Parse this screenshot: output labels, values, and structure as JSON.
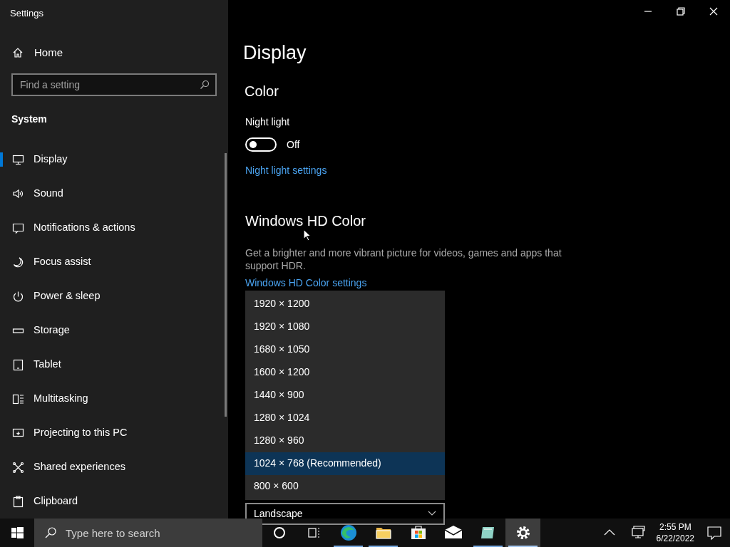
{
  "window": {
    "title": "Settings"
  },
  "sidebar": {
    "home": "Home",
    "search": {
      "placeholder": "Find a setting"
    },
    "section": "System",
    "items": [
      {
        "kind": "display",
        "label": "Display",
        "selected": true
      },
      {
        "kind": "sound",
        "label": "Sound",
        "selected": false
      },
      {
        "kind": "notifications",
        "label": "Notifications & actions",
        "selected": false
      },
      {
        "kind": "focus",
        "label": "Focus assist",
        "selected": false
      },
      {
        "kind": "power",
        "label": "Power & sleep",
        "selected": false
      },
      {
        "kind": "storage",
        "label": "Storage",
        "selected": false
      },
      {
        "kind": "tablet",
        "label": "Tablet",
        "selected": false
      },
      {
        "kind": "multitasking",
        "label": "Multitasking",
        "selected": false
      },
      {
        "kind": "projecting",
        "label": "Projecting to this PC",
        "selected": false
      },
      {
        "kind": "shared",
        "label": "Shared experiences",
        "selected": false
      },
      {
        "kind": "clipboard",
        "label": "Clipboard",
        "selected": false
      }
    ]
  },
  "content": {
    "title": "Display",
    "section": "Color",
    "night_light": {
      "label": "Night light",
      "on": false,
      "state_text": "Off",
      "link": "Night light settings"
    },
    "hd_color": {
      "heading": "Windows HD Color",
      "description": "Get a brighter and more vibrant picture for videos, games and apps that support HDR.",
      "link": "Windows HD Color settings"
    },
    "resolution_options": [
      {
        "label": "1920 × 1200",
        "selected": false
      },
      {
        "label": "1920 × 1080",
        "selected": false
      },
      {
        "label": "1680 × 1050",
        "selected": false
      },
      {
        "label": "1600 × 1200",
        "selected": false
      },
      {
        "label": "1440 × 900",
        "selected": false
      },
      {
        "label": "1280 × 1024",
        "selected": false
      },
      {
        "label": "1280 × 960",
        "selected": false
      },
      {
        "label": "1024 × 768 (Recommended)",
        "selected": true
      },
      {
        "label": "800 × 600",
        "selected": false
      }
    ],
    "orientation": {
      "value": "Landscape"
    }
  },
  "taskbar": {
    "search": {
      "placeholder": "Type here to search"
    },
    "apps": [
      {
        "kind": "browser",
        "running": true,
        "selected": false
      },
      {
        "kind": "folder",
        "running": true,
        "selected": false
      },
      {
        "kind": "store",
        "running": false,
        "selected": false
      },
      {
        "kind": "mail",
        "running": false,
        "selected": false
      },
      {
        "kind": "app",
        "running": true,
        "selected": false
      },
      {
        "kind": "settings",
        "running": true,
        "selected": true
      }
    ],
    "time": "2:55 PM",
    "date": "6/22/2022"
  }
}
